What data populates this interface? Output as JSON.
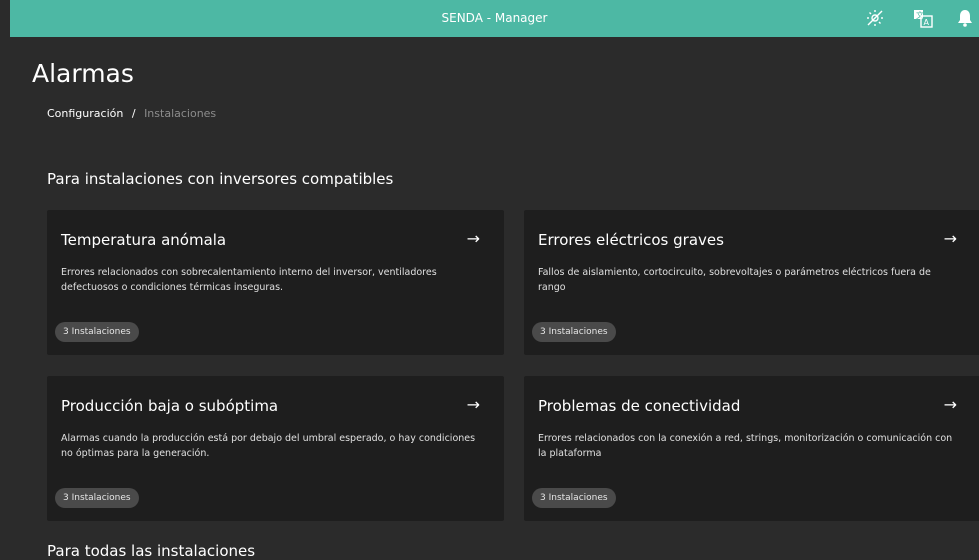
{
  "header": {
    "title": "SENDA - Manager",
    "icons": [
      "no-sun-icon",
      "translate-icon",
      "bell-icon"
    ],
    "background": "#4db8a4"
  },
  "page": {
    "title": "Alarmas",
    "breadcrumb": {
      "link": "Configuración",
      "separator": "/",
      "current": "Instalaciones"
    }
  },
  "section": {
    "title": "Para instalaciones con inversores compatibles"
  },
  "cards": [
    {
      "title": "Temperatura anómala",
      "arrow": "→",
      "description": "Errores relacionados con sobrecalentamiento interno del inversor, ventiladores defectuosos o condiciones térmicas inseguras.",
      "badge": "3 Instalaciones"
    },
    {
      "title": "Errores eléctricos graves",
      "arrow": "→",
      "description": "Fallos de aislamiento, cortocircuito, sobrevoltajes o parámetros eléctricos fuera de rango",
      "badge": "3 Instalaciones"
    },
    {
      "title": "Producción baja o subóptima",
      "arrow": "→",
      "description": "Alarmas cuando la producción está por debajo del umbral esperado, o hay condiciones no óptimas para la generación.",
      "badge": "3 Instalaciones"
    },
    {
      "title": "Problemas de conectividad",
      "arrow": "→",
      "description": "Errores relacionados con la conexión a red, strings, monitorización o comunicación con la plataforma",
      "badge": "3 Instalaciones"
    }
  ],
  "next_section": {
    "title": "Para todas las instalaciones"
  }
}
